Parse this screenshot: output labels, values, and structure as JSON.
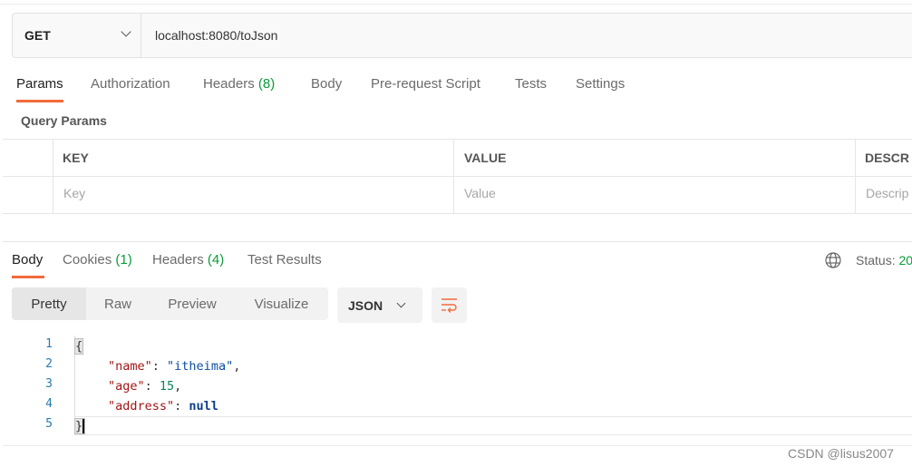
{
  "request": {
    "method": "GET",
    "url": "localhost:8080/toJson"
  },
  "request_tabs": [
    {
      "label": "Params"
    },
    {
      "label": "Authorization"
    },
    {
      "label": "Headers",
      "count": "(8)"
    },
    {
      "label": "Body"
    },
    {
      "label": "Pre-request Script"
    },
    {
      "label": "Tests"
    },
    {
      "label": "Settings"
    }
  ],
  "query_params": {
    "title": "Query Params",
    "columns": [
      "KEY",
      "VALUE",
      "DESCR"
    ],
    "placeholders": [
      "Key",
      "Value",
      "Descrip"
    ]
  },
  "response_tabs": [
    {
      "label": "Body"
    },
    {
      "label": "Cookies",
      "count": "(1)"
    },
    {
      "label": "Headers",
      "count": "(4)"
    },
    {
      "label": "Test Results"
    }
  ],
  "status": {
    "label": "Status:",
    "value": "20"
  },
  "view_modes": [
    "Pretty",
    "Raw",
    "Preview",
    "Visualize"
  ],
  "format": "JSON",
  "code": {
    "line_numbers": [
      "1",
      "2",
      "3",
      "4",
      "5"
    ],
    "open": "{",
    "close": "}",
    "name_key": "\"name\"",
    "name_val": "\"itheima\"",
    "age_key": "\"age\"",
    "age_val": "15",
    "address_key": "\"address\"",
    "address_val": "null"
  },
  "watermark": "CSDN @lisus2007",
  "colors": {
    "accent": "#f26b3a",
    "count_green": "#0a9b3a"
  }
}
